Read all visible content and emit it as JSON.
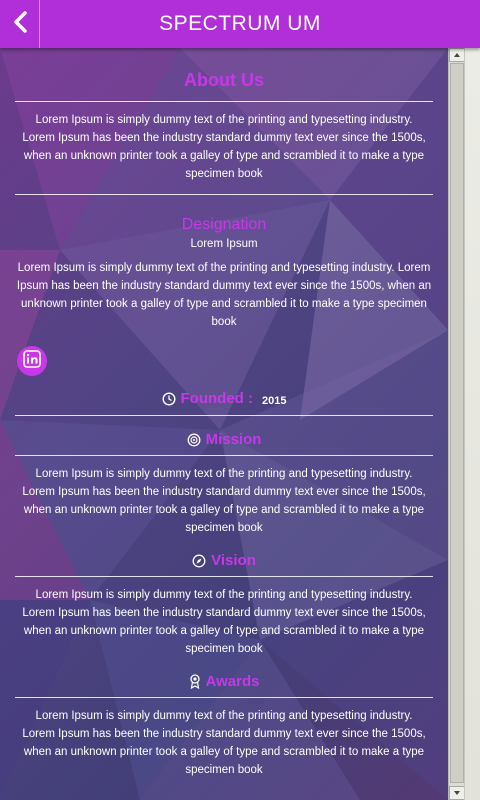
{
  "app": {
    "title": "SPECTRUM UM"
  },
  "about": {
    "heading": "About Us",
    "text": "Lorem Ipsum is simply dummy text of the printing and typesetting industry. Lorem Ipsum has been the industry standard dummy text ever since the 1500s, when an unknown printer took a galley of type and scrambled it to make a type specimen book"
  },
  "designation": {
    "heading": "Designation",
    "name": "Lorem Ipsum",
    "text": "Lorem Ipsum is simply dummy text of the printing and typesetting industry. Lorem Ipsum has been the industry standard dummy text ever since the 1500s, when an unknown printer took a galley of type and scrambled it to make a type specimen book"
  },
  "social": {
    "icon": "linkedin-icon"
  },
  "founded": {
    "label": "Founded :",
    "year": "2015",
    "icon": "clock-icon"
  },
  "mission": {
    "heading": "Mission",
    "icon": "target-icon",
    "text": "Lorem Ipsum is simply dummy text of the printing and typesetting industry. Lorem Ipsum has been the industry standard dummy text ever since the 1500s, when an unknown printer took a galley of type and scrambled it to make a type specimen book"
  },
  "vision": {
    "heading": "Vision",
    "icon": "compass-icon",
    "text": "Lorem Ipsum is simply dummy text of the printing and typesetting industry. Lorem Ipsum has been the industry standard dummy text ever since the 1500s, when an unknown printer took a galley of type and scrambled it to make a type specimen book"
  },
  "awards": {
    "heading": "Awards",
    "icon": "award-icon",
    "text": "Lorem Ipsum is simply dummy text of the printing and typesetting industry. Lorem Ipsum has been the industry standard dummy text ever since the 1500s, when an unknown printer took a galley of type and scrambled it to make a type specimen book"
  },
  "colors": {
    "accent": "#b02fd8",
    "heading": "#c738e8"
  }
}
